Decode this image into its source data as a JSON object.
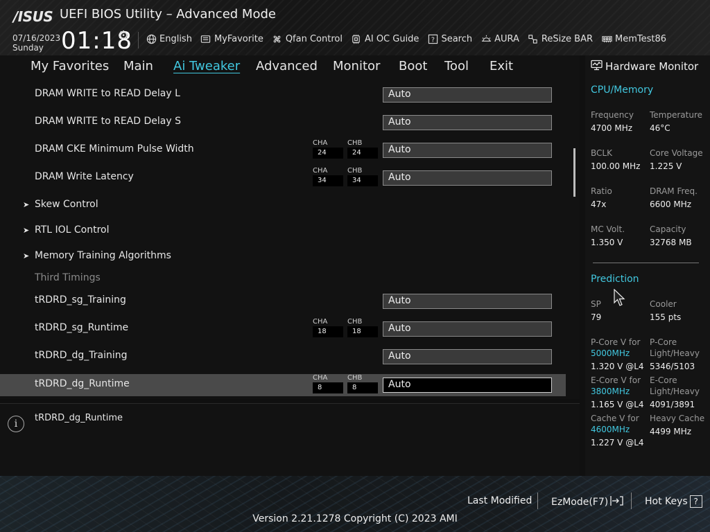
{
  "header": {
    "logo": "/ISUS",
    "title": "UEFI BIOS Utility – Advanced Mode",
    "date": "07/16/2023",
    "day": "Sunday",
    "time": "01:18",
    "toolbar": [
      {
        "label": "English",
        "icon": "globe-icon"
      },
      {
        "label": "MyFavorite",
        "icon": "favorite-icon"
      },
      {
        "label": "Qfan Control",
        "icon": "fan-icon"
      },
      {
        "label": "AI OC Guide",
        "icon": "ai-oc-guide-icon"
      },
      {
        "label": "Search",
        "icon": "search-icon"
      },
      {
        "label": "AURA",
        "icon": "aura-icon"
      },
      {
        "label": "ReSize BAR",
        "icon": "resize-bar-icon"
      },
      {
        "label": "MemTest86",
        "icon": "memtest-icon"
      }
    ]
  },
  "nav": {
    "tabs": [
      "My Favorites",
      "Main",
      "Ai Tweaker",
      "Advanced",
      "Monitor",
      "Boot",
      "Tool",
      "Exit"
    ],
    "active": "Ai Tweaker"
  },
  "ch_labels": {
    "a": "CHA",
    "b": "CHB"
  },
  "settings": [
    {
      "label": "DRAM WRITE to READ Delay L",
      "value": "Auto"
    },
    {
      "label": "DRAM WRITE to READ Delay S",
      "value": "Auto"
    },
    {
      "label": "DRAM CKE Minimum Pulse Width",
      "cha": "24",
      "chb": "24",
      "value": "Auto"
    },
    {
      "label": "DRAM Write Latency",
      "cha": "34",
      "chb": "34",
      "value": "Auto"
    },
    {
      "label": "Skew Control",
      "submenu": true
    },
    {
      "label": "RTL IOL Control",
      "submenu": true
    },
    {
      "label": "Memory Training Algorithms",
      "submenu": true
    },
    {
      "label": "Third Timings",
      "header": true
    },
    {
      "label": "tRDRD_sg_Training",
      "value": "Auto"
    },
    {
      "label": "tRDRD_sg_Runtime",
      "cha": "18",
      "chb": "18",
      "value": "Auto"
    },
    {
      "label": "tRDRD_dg_Training",
      "value": "Auto"
    },
    {
      "label": "tRDRD_dg_Runtime",
      "cha": "8",
      "chb": "8",
      "value": "Auto",
      "selected": true
    }
  ],
  "help": {
    "text": "tRDRD_dg_Runtime"
  },
  "hw_monitor": {
    "title": "Hardware Monitor",
    "cpu_mem": {
      "title": "CPU/Memory",
      "frequency_label": "Frequency",
      "frequency": "4700 MHz",
      "temperature_label": "Temperature",
      "temperature": "46°C",
      "bclk_label": "BCLK",
      "bclk": "100.00 MHz",
      "core_voltage_label": "Core Voltage",
      "core_voltage": "1.225 V",
      "ratio_label": "Ratio",
      "ratio": "47x",
      "dram_freq_label": "DRAM Freq.",
      "dram_freq": "6600 MHz",
      "mc_volt_label": "MC Volt.",
      "mc_volt": "1.350 V",
      "capacity_label": "Capacity",
      "capacity": "32768 MB"
    },
    "prediction": {
      "title": "Prediction",
      "sp_label": "SP",
      "sp": "79",
      "cooler_label": "Cooler",
      "cooler": "155 pts",
      "pcore_v_label": "P-Core V for",
      "pcore_v_freq": "5000MHz",
      "pcore_v": "1.320 V @L4",
      "pcore_lh_label_1": "P-Core",
      "pcore_lh_label_2": "Light/Heavy",
      "pcore_lh": "5346/5103",
      "ecore_v_label": "E-Core V for",
      "ecore_v_freq": "3800MHz",
      "ecore_v": "1.165 V @L4",
      "ecore_lh_label_1": "E-Core",
      "ecore_lh_label_2": "Light/Heavy",
      "ecore_lh": "4091/3891",
      "cache_v_label": "Cache V for",
      "cache_v_freq": "4600MHz",
      "cache_v": "1.227 V @L4",
      "heavy_cache_label": "Heavy Cache",
      "heavy_cache": "4499 MHz"
    }
  },
  "footer": {
    "last_modified": "Last Modified",
    "ezmode": "EzMode(F7)",
    "hotkeys": "Hot Keys",
    "hotkeys_icon": "?",
    "version": "Version 2.21.1278 Copyright (C) 2023 AMI"
  }
}
